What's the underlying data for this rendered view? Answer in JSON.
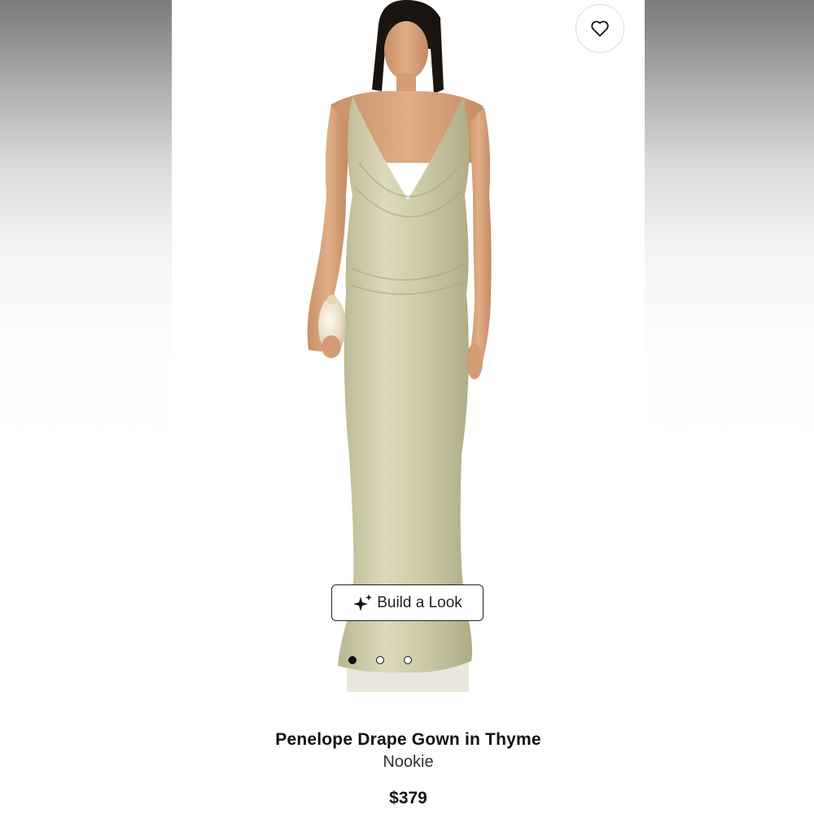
{
  "product": {
    "name": "Penelope Drape Gown in Thyme",
    "brand": "Nookie",
    "price": "$379",
    "image_alt": "Model wearing Penelope Drape Gown in Thyme"
  },
  "actions": {
    "build_look_label": "Build a Look",
    "favorite_icon": "heart-icon",
    "sparkle_icon": "sparkle-icon"
  },
  "carousel": {
    "total": 3,
    "active_index": 0
  },
  "colors": {
    "gown": "#c9c6a3",
    "skin": "#d9a47c",
    "hair": "#1a1410"
  }
}
